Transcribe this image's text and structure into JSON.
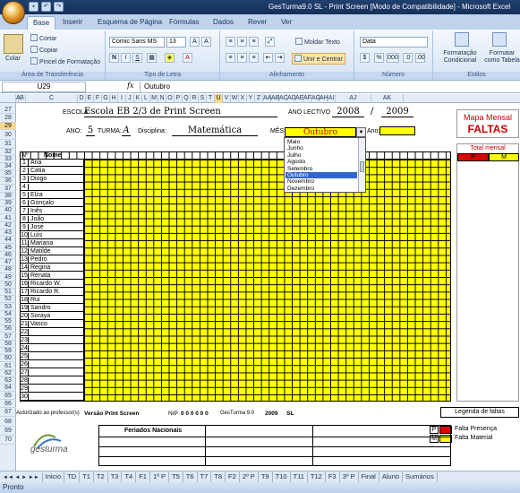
{
  "window": {
    "title": "GesTurma9.0 SL - Print Screen  [Modo de Compatibilidade] - Microsoft Excel"
  },
  "ribbon_tabs": [
    "Base",
    "Inserir",
    "Esquema de Página",
    "Fórmulas",
    "Dados",
    "Rever",
    "Ver"
  ],
  "ribbon": {
    "clipboard": {
      "paste": "Colar",
      "cut": "Cortar",
      "copy": "Copiar",
      "format_painter": "Pincel de Formatação",
      "label": "Área de Transferência"
    },
    "font": {
      "name": "Comic Sans MS",
      "size": "13",
      "label": "Tipo de Letra"
    },
    "alignment": {
      "wrap": "Moldar Texto",
      "merge": "Unir e Centrar",
      "label": "Alinhamento"
    },
    "number": {
      "format": "Data",
      "label": "Número"
    },
    "styles": {
      "conditional": "Formatação Condicional",
      "table": "Formatar como Tabela",
      "label": "Estilos"
    }
  },
  "formula_bar": {
    "cell": "U29",
    "fx": "fx",
    "value": "Outubro"
  },
  "columns": [
    "A",
    "B",
    "C",
    "D",
    "E",
    "F",
    "G",
    "H",
    "I",
    "J",
    "K",
    "L",
    "M",
    "N",
    "O",
    "P",
    "Q",
    "R",
    "S",
    "T",
    "U",
    "V",
    "W",
    "X",
    "Y",
    "Z",
    "AA",
    "AB",
    "AC",
    "AD",
    "AE",
    "AF",
    "AG",
    "AH",
    "AI",
    "AJ",
    "AK"
  ],
  "rows": [
    "27",
    "28",
    "29",
    "30",
    "31",
    "32",
    "33",
    "34",
    "35",
    "36",
    "37",
    "38",
    "39",
    "40",
    "41",
    "42",
    "43",
    "44",
    "45",
    "46",
    "47",
    "48",
    "49",
    "50",
    "51",
    "52",
    "53",
    "54",
    "55",
    "56",
    "57",
    "58",
    "59",
    "60",
    "61",
    "62",
    "63",
    "64",
    "65",
    "66",
    "67",
    "68",
    "69",
    "70"
  ],
  "sheet": {
    "escola_label": "ESCOLA",
    "escola": "Escola EB 2/3 de Print Screen",
    "ano_lectivo_label": "ANO LECTIVO",
    "ano_from": "2008",
    "ano_sep": "/",
    "ano_to": "2009",
    "ano_label": "ANO:",
    "ano": "5",
    "turma_label": "TURMA:",
    "turma": "A",
    "disciplina_label": "Disciplina:",
    "disciplina": "Matemática",
    "mes_label": "MÊS:",
    "mes": "Outubro",
    "ano2_label": "Ano:",
    "mapa_title": "Mapa Mensal",
    "mapa_sub": "FALTAS",
    "total_mensal": "Total mensal",
    "p": "P",
    "m": "M",
    "no_header": "Nº",
    "nome_header": "Nome",
    "autorizado": "Autorizado ao professor(s)",
    "versao": "Versão Print Screen",
    "nip_label": "NIP",
    "nip": "0 0 0 0 0 0",
    "gesturma": "GesTurma 9.0",
    "year": "2009",
    "sl": "SL",
    "legenda": "Legenda de faltas",
    "feriados": "Feriados Nacionais",
    "falta_presenca": "Falta Presença",
    "falta_material": "Falta Material",
    "logo": "gesturma"
  },
  "students": [
    {
      "n": "1",
      "name": "Ana"
    },
    {
      "n": "2",
      "name": "Cátia"
    },
    {
      "n": "3",
      "name": "Diogo"
    },
    {
      "n": "4",
      "name": ""
    },
    {
      "n": "5",
      "name": "Elza"
    },
    {
      "n": "6",
      "name": "Gonçalo"
    },
    {
      "n": "7",
      "name": "Inês"
    },
    {
      "n": "8",
      "name": "João"
    },
    {
      "n": "9",
      "name": "José"
    },
    {
      "n": "10",
      "name": "Luís"
    },
    {
      "n": "11",
      "name": "Mariana"
    },
    {
      "n": "12",
      "name": "Matilde"
    },
    {
      "n": "13",
      "name": "Pedro"
    },
    {
      "n": "14",
      "name": "Regina"
    },
    {
      "n": "15",
      "name": "Renata"
    },
    {
      "n": "16",
      "name": "Ricardo W."
    },
    {
      "n": "17",
      "name": "Ricardo R."
    },
    {
      "n": "18",
      "name": "Rui"
    },
    {
      "n": "19",
      "name": "Sandro"
    },
    {
      "n": "20",
      "name": "Soraya"
    },
    {
      "n": "21",
      "name": "Vasco"
    },
    {
      "n": "22",
      "name": ""
    },
    {
      "n": "23",
      "name": ""
    },
    {
      "n": "24",
      "name": ""
    },
    {
      "n": "25",
      "name": ""
    },
    {
      "n": "26",
      "name": ""
    },
    {
      "n": "27",
      "name": ""
    },
    {
      "n": "28",
      "name": ""
    },
    {
      "n": "29",
      "name": ""
    },
    {
      "n": "30",
      "name": ""
    }
  ],
  "dropdown_months": [
    "Maio",
    "Junho",
    "Julho",
    "Agosto",
    "Setembro",
    "Outubro",
    "Novembro",
    "Dezembro"
  ],
  "sheet_tabs": [
    "Inicio",
    "TD",
    "T1",
    "T2",
    "T3",
    "T4",
    "F1",
    "1º P",
    "T5",
    "T6",
    "T7",
    "T8",
    "F2",
    "2º P",
    "T9",
    "T10",
    "T11",
    "T12",
    "F3",
    "3º P",
    "Final",
    "Aluno",
    "Sumários"
  ],
  "status": "Pronto",
  "colors": {
    "yellow": "#ffff00",
    "red": "#cc0000",
    "select": "#3366cc"
  }
}
